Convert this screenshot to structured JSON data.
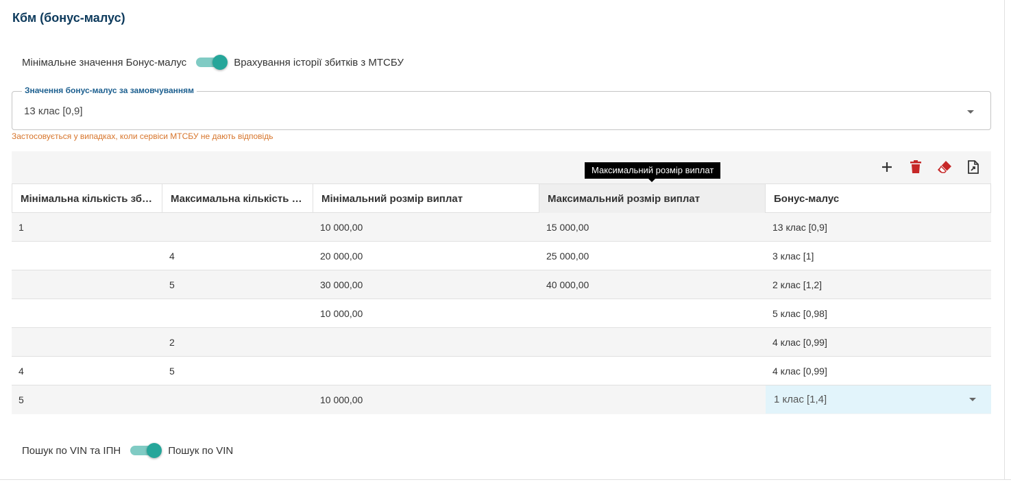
{
  "page": {
    "title": "Кбм (бонус-малус)"
  },
  "switch_top": {
    "left_label": "Мінімальне значення Бонус-малус",
    "right_label": "Врахування історії збитків з МТСБУ",
    "state": "right"
  },
  "default_select": {
    "legend": "Значення бонус-малус за замовчуванням",
    "value": "13 клас [0,9]",
    "helper": "Застосовується у випадках, коли сервіси МТСБУ не дають відповідь"
  },
  "toolbar": {
    "icons": [
      "add-icon",
      "delete-icon",
      "eraser-icon",
      "export-icon"
    ],
    "colors": {
      "add": "#333333",
      "delete": "#c62828",
      "eraser": "#c62828",
      "export": "#333333"
    }
  },
  "tooltip": {
    "text": "Максимальний розмір виплат"
  },
  "table": {
    "headers": [
      "Мінімальна кількість збитків",
      "Максимальна кількість збитків",
      "Мінімальний розмір виплат",
      "Максимальний розмір виплат",
      "Бонус-малус"
    ],
    "rows": [
      [
        "1",
        "",
        "10 000,00",
        "15 000,00",
        "13 клас [0,9]"
      ],
      [
        "",
        "4",
        "20 000,00",
        "25 000,00",
        "3 клас [1]"
      ],
      [
        "",
        "5",
        "30 000,00",
        "40 000,00",
        "2 клас [1,2]"
      ],
      [
        "",
        "",
        "10 000,00",
        "",
        "5 клас [0,98]"
      ],
      [
        "",
        "2",
        "",
        "",
        "4 клас [0,99]"
      ],
      [
        "4",
        "5",
        "",
        "",
        "4 клас [0,99]"
      ],
      [
        "5",
        "",
        "10 000,00",
        "",
        "1 клас [1,4]"
      ]
    ]
  },
  "switch_bottom": {
    "left_label": "Пошук по VIN та ІПН",
    "right_label": "Пошук по VIN",
    "state": "right"
  },
  "colors": {
    "title": "#0d3a5c",
    "toggle_thumb": "#26a69a",
    "toggle_track": "#80cbc4",
    "helper": "#d7742a",
    "legend": "#1c5f8f",
    "editing_cell": "#e2f4fb"
  }
}
